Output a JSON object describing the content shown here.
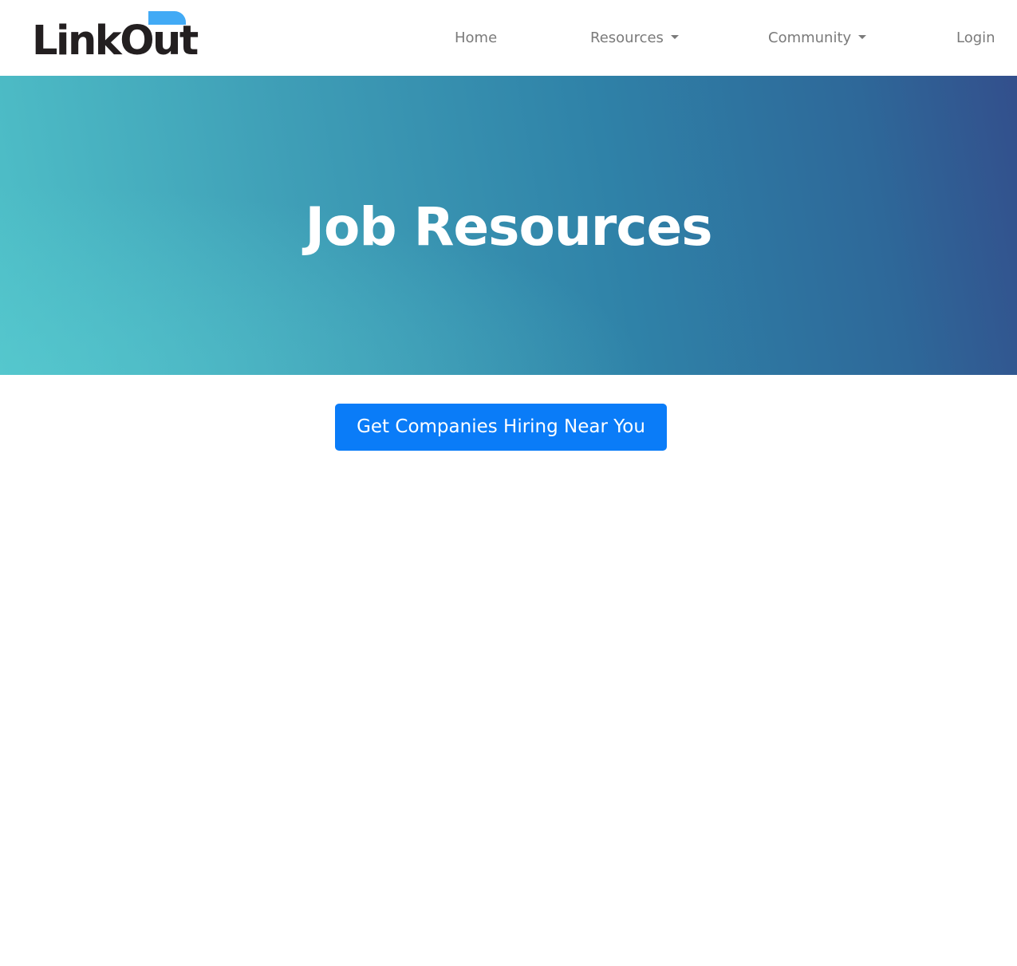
{
  "header": {
    "logo_text": "LinkOut",
    "nav": {
      "home": "Home",
      "resources": "Resources",
      "community": "Community",
      "login": "Login"
    }
  },
  "hero": {
    "title": "Job Resources"
  },
  "main": {
    "cta_label": "Get Companies Hiring Near You"
  },
  "colors": {
    "brand_accent": "#42aaf5",
    "cta_blue": "#0a7cf8",
    "hero_gradient_start": "#4fc0c8",
    "hero_gradient_end": "#334f8c",
    "nav_text": "#7a7a7a"
  }
}
